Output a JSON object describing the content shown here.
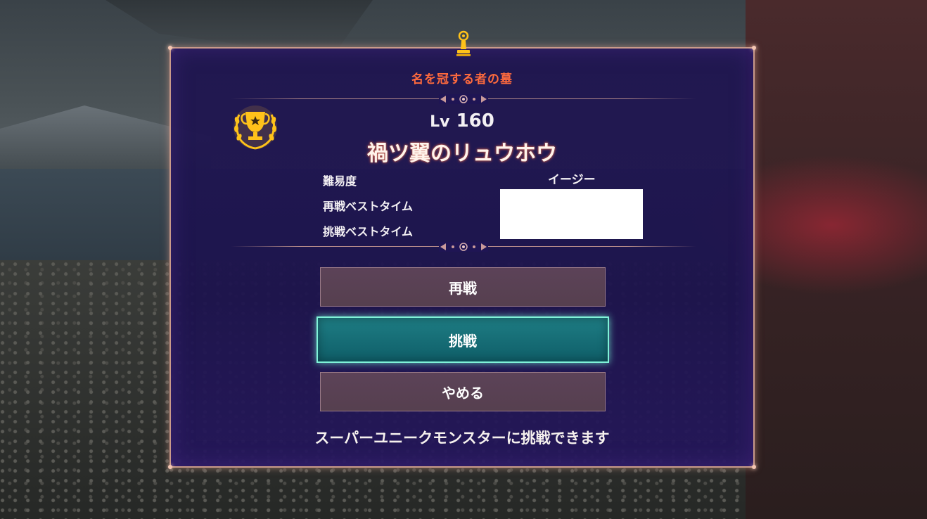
{
  "dialog": {
    "title": "名を冠する者の墓",
    "level_prefix": "Lv",
    "level_value": "160",
    "monster_name": "禍ツ翼のリュウホウ",
    "stats": [
      {
        "label": "難易度",
        "value": "イージー"
      },
      {
        "label": "再戦ベストタイム",
        "value": ""
      },
      {
        "label": "挑戦ベストタイム",
        "value": ""
      }
    ],
    "buttons": {
      "rematch": "再戦",
      "challenge": "挑戦",
      "cancel": "やめる"
    },
    "footer": "スーパーユニークモンスターに挑戦できます"
  },
  "icons": {
    "top": "beacon-icon",
    "badge": "trophy-laurel-icon"
  },
  "colors": {
    "title": "#ff6a3d",
    "primary_button": "#1e7d84",
    "primary_border": "#7ff2d8",
    "button": "#5c4258",
    "panel": "#1e1450"
  }
}
